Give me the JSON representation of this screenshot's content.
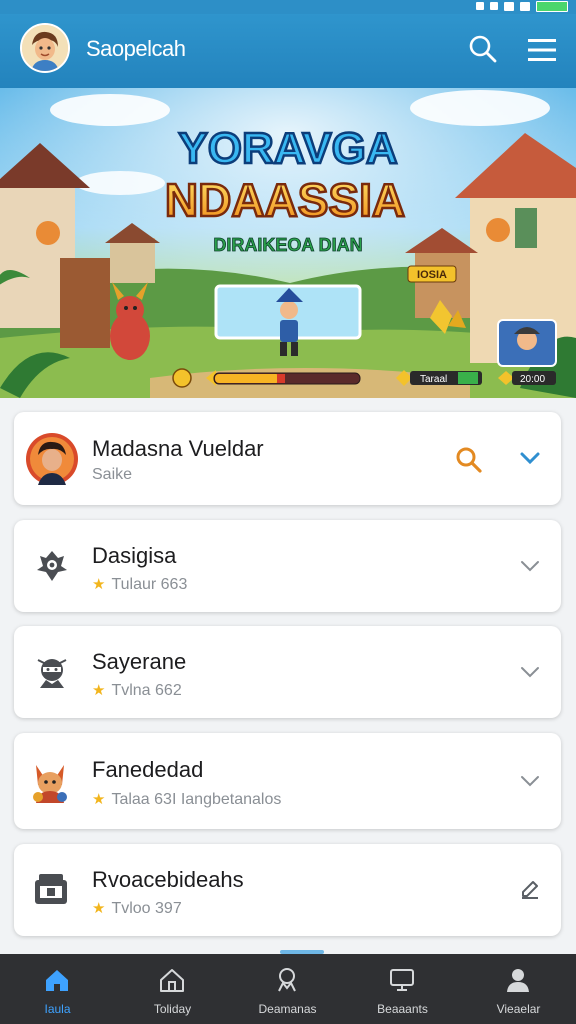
{
  "header": {
    "title": "Saopelcah"
  },
  "banner": {
    "title_line1": "YORAVGA",
    "title_line2": "NDAASSIA",
    "subtitle": "DIRAIKEOA DIAN",
    "badge": "IOSIA",
    "hud_left_percent": 45,
    "hud_right_text": "Taraal",
    "hud_right_value": "20:00"
  },
  "list": {
    "items": [
      {
        "title": "Madasna Vueldar",
        "subtitle": "Saike",
        "star": false,
        "expanded": true
      },
      {
        "title": "Dasigisa",
        "subtitle": "Tulaur 663",
        "star": true
      },
      {
        "title": "Sayerane",
        "subtitle": "Tvlna 662",
        "star": true
      },
      {
        "title": "Fanededad",
        "subtitle": "Talaa 63I  Iangbetanalos",
        "star": true
      },
      {
        "title": "Rvoacebideahs",
        "subtitle": "Tvloo 397",
        "star": true
      }
    ]
  },
  "nav": {
    "items": [
      {
        "label": "Iaula"
      },
      {
        "label": "Toliday"
      },
      {
        "label": "Deamanas"
      },
      {
        "label": "Beaaants"
      },
      {
        "label": "Vieaelar"
      }
    ]
  },
  "colors": {
    "header": "#2d8fc7",
    "accent": "#3ea2ff",
    "star": "#f2b51d",
    "nav_bg": "#2f3033"
  }
}
